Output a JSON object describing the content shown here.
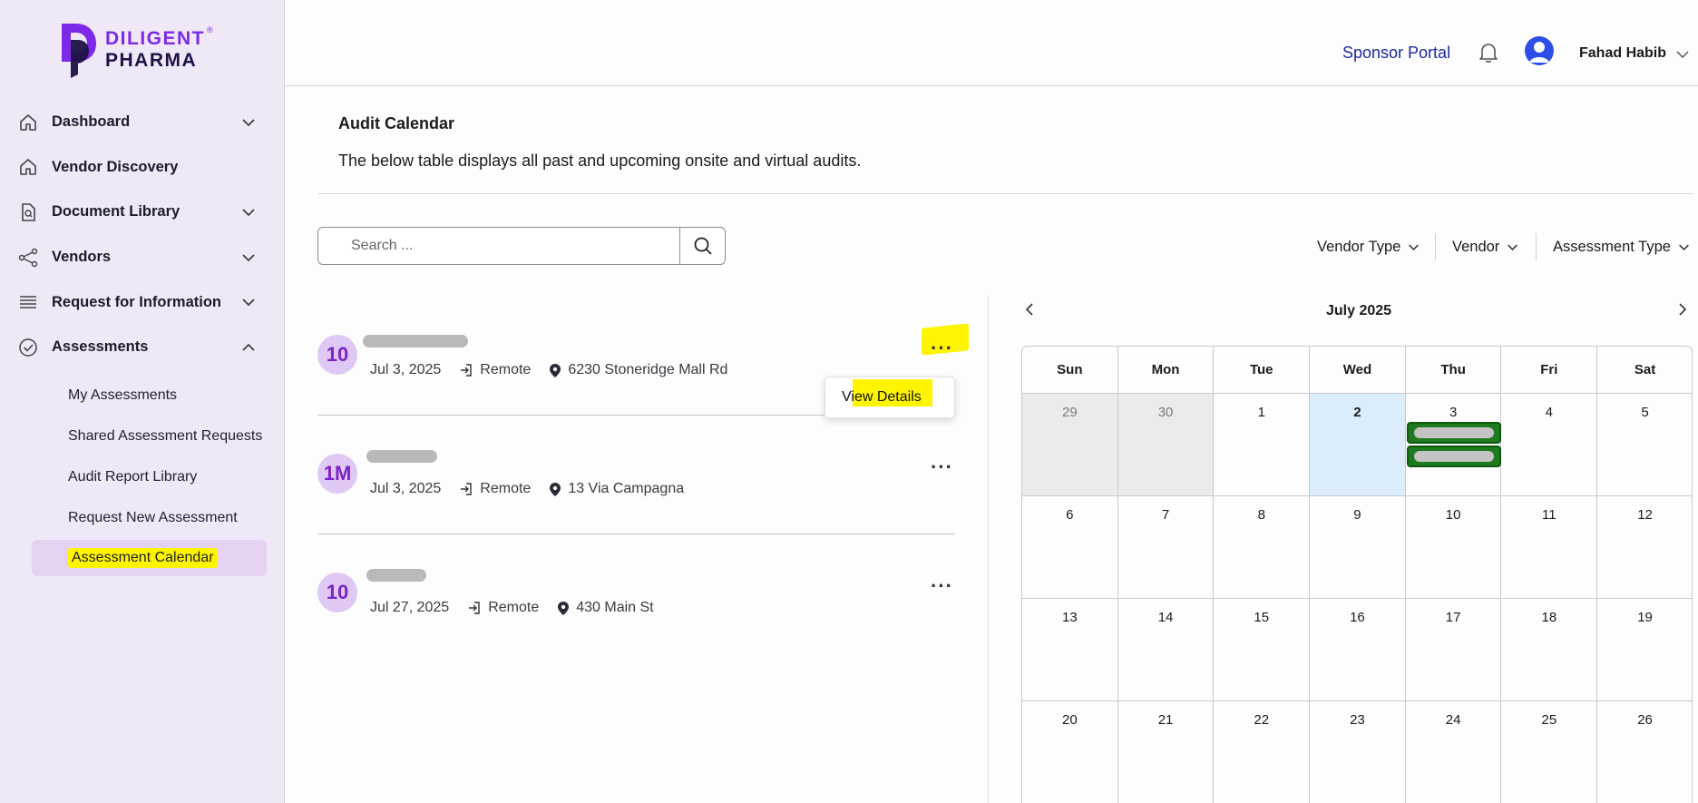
{
  "brand": {
    "line1": "DILIGENT",
    "line2": "PHARMA",
    "reg": "®"
  },
  "sidebar": {
    "items": [
      {
        "label": "Dashboard",
        "icon": "home-icon",
        "chevron": "down"
      },
      {
        "label": "Vendor Discovery",
        "icon": "home-icon",
        "chevron": "none"
      },
      {
        "label": "Document Library",
        "icon": "document-search-icon",
        "chevron": "down"
      },
      {
        "label": "Vendors",
        "icon": "share-icon",
        "chevron": "down"
      },
      {
        "label": "Request for Information",
        "icon": "list-icon",
        "chevron": "down"
      },
      {
        "label": "Assessments",
        "icon": "check-circle-icon",
        "chevron": "up"
      }
    ],
    "sub_items": [
      {
        "label": "My Assessments"
      },
      {
        "label": "Shared Assessment Requests"
      },
      {
        "label": "Audit Report Library"
      },
      {
        "label": "Request New Assessment"
      },
      {
        "label": "Assessment Calendar",
        "active": true
      }
    ]
  },
  "header": {
    "portal": "Sponsor Portal",
    "bell_icon": "bell-icon",
    "user_name": "Fahad Habib"
  },
  "main": {
    "title": "Audit Calendar",
    "description": "The below table displays all past and upcoming onsite and virtual audits."
  },
  "search": {
    "placeholder": "Search ..."
  },
  "filters": [
    "Vendor Type",
    "Vendor",
    "Assessment Type"
  ],
  "audits": [
    {
      "badge": "10",
      "date": "Jul 3, 2025",
      "mode": "Remote",
      "address": "6230 Stoneridge Mall Rd"
    },
    {
      "badge": "1M",
      "date": "Jul 3, 2025",
      "mode": "Remote",
      "address": "13 Via Campagna"
    },
    {
      "badge": "10",
      "date": "Jul 27, 2025",
      "mode": "Remote",
      "address": "430 Main St"
    }
  ],
  "row_menu": {
    "more_label": "···",
    "item": "View Details"
  },
  "calendar": {
    "month": "July 2025",
    "weekdays": [
      "Sun",
      "Mon",
      "Tue",
      "Wed",
      "Thu",
      "Fri",
      "Sat"
    ],
    "weeks": [
      [
        "29",
        "30",
        "1",
        "2",
        "3",
        "4",
        "5"
      ],
      [
        "6",
        "7",
        "8",
        "9",
        "10",
        "11",
        "12"
      ],
      [
        "13",
        "14",
        "15",
        "16",
        "17",
        "18",
        "19"
      ],
      [
        "20",
        "21",
        "22",
        "23",
        "24",
        "25",
        "26"
      ]
    ],
    "today": "2",
    "event_color": "#1f7a1f"
  },
  "colors": {
    "accent": "#7c2ae8",
    "sidebar_bg": "#f1e8f7",
    "highlight": "#fff400",
    "portal_link": "#1a2a9e"
  }
}
